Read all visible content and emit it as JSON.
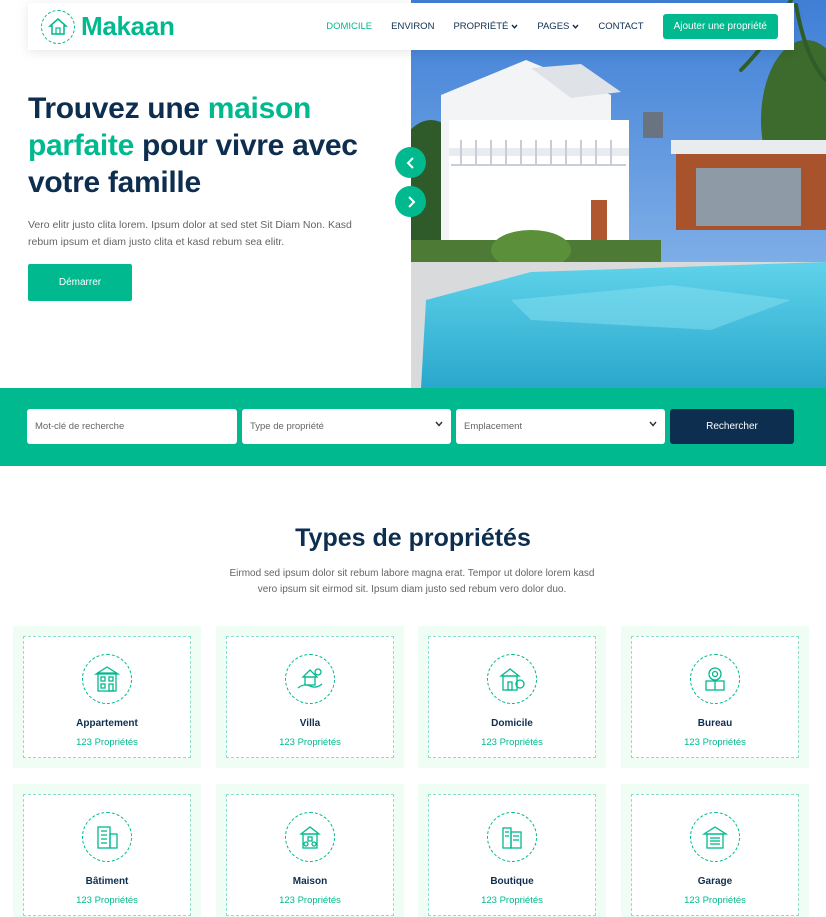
{
  "brand": {
    "name": "Makaan"
  },
  "nav": {
    "items": [
      {
        "label": "DOMICILE",
        "active": true,
        "dropdown": false
      },
      {
        "label": "ENVIRON",
        "active": false,
        "dropdown": false
      },
      {
        "label": "PROPRIÉTÉ",
        "active": false,
        "dropdown": true
      },
      {
        "label": "PAGES",
        "active": false,
        "dropdown": true
      },
      {
        "label": "CONTACT",
        "active": false,
        "dropdown": false
      }
    ],
    "cta_label": "Ajouter une propriété"
  },
  "hero": {
    "title_part1": "Trouvez une ",
    "title_accent": "maison parfaite",
    "title_part2": " pour vivre avec votre famille",
    "description": "Vero elitr justo clita lorem. Ipsum dolor at sed stet Sit Diam Non. Kasd rebum ipsum et diam justo clita et kasd rebum sea elitr.",
    "button_label": "Démarrer"
  },
  "search": {
    "keyword_placeholder": "Mot-clé de recherche",
    "type_label": "Type de propriété",
    "location_label": "Emplacement",
    "button_label": "Rechercher"
  },
  "types_section": {
    "title": "Types de propriétés",
    "description": "Eirmod sed ipsum dolor sit rebum labore magna erat. Tempor ut dolore lorem kasd vero ipsum sit eirmod sit. Ipsum diam justo sed rebum vero dolor duo.",
    "cards": [
      {
        "name": "Appartement",
        "count": "123 Propriétés",
        "icon": "apartment-icon"
      },
      {
        "name": "Villa",
        "count": "123 Propriétés",
        "icon": "villa-icon"
      },
      {
        "name": "Domicile",
        "count": "123 Propriétés",
        "icon": "home-icon"
      },
      {
        "name": "Bureau",
        "count": "123 Propriétés",
        "icon": "office-icon"
      },
      {
        "name": "Bâtiment",
        "count": "123 Propriétés",
        "icon": "building-icon"
      },
      {
        "name": "Maison",
        "count": "123 Propriétés",
        "icon": "house-icon"
      },
      {
        "name": "Boutique",
        "count": "123 Propriétés",
        "icon": "shop-icon"
      },
      {
        "name": "Garage",
        "count": "123 Propriétés",
        "icon": "garage-icon"
      }
    ]
  },
  "colors": {
    "primary": "#00b98e",
    "dark": "#0e2e50",
    "light": "#effdf5",
    "text": "#666565"
  }
}
